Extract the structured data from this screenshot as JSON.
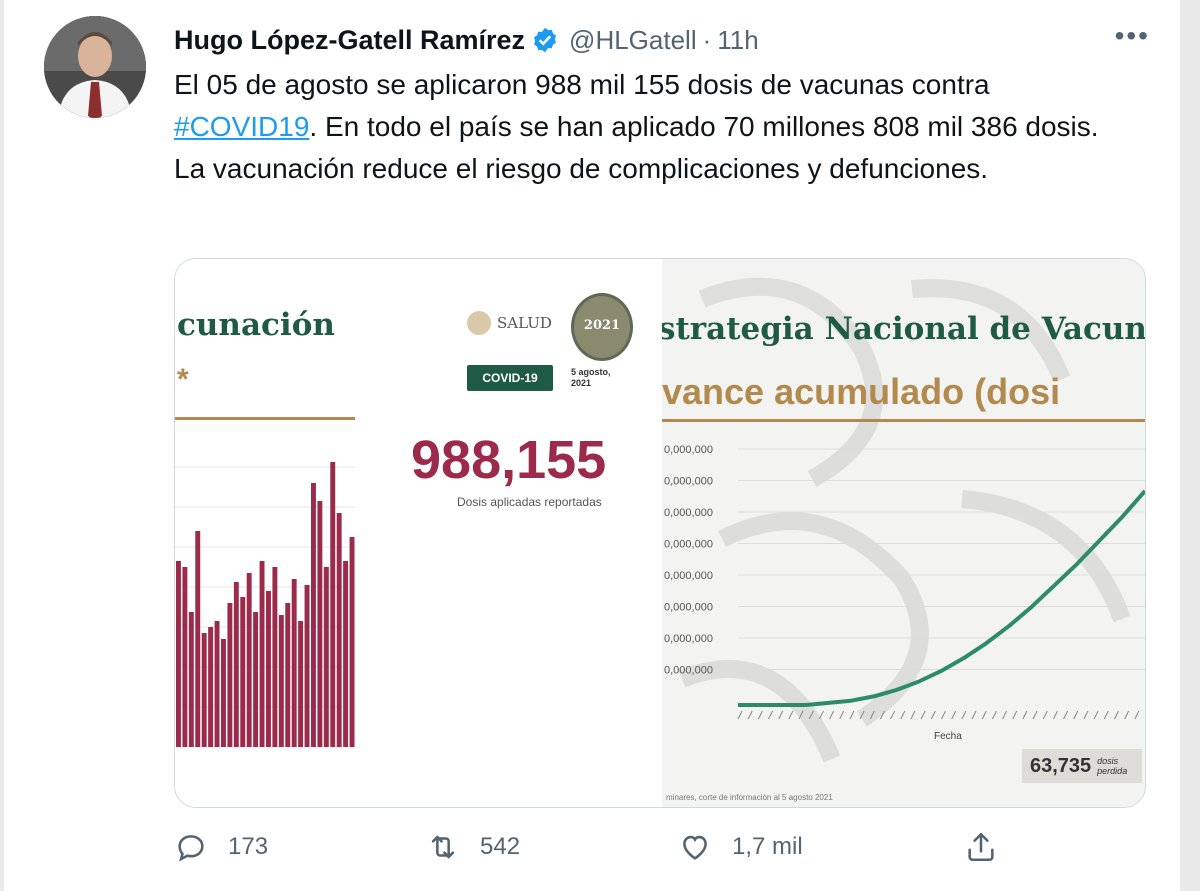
{
  "author": {
    "name": "Hugo López-Gatell Ramírez",
    "handle": "@HLGatell",
    "separator": "·",
    "time": "11h"
  },
  "more_menu": "•••",
  "tweet": {
    "text_before": "El 05 de agosto se aplicaron 988 mil 155 dosis de vacunas contra ",
    "hashtag": "#COVID19",
    "text_after": ". En todo el país se han aplicado 70 millones 808 mil 386 dosis. La vacunación reduce el riesgo de complicaciones y defunciones."
  },
  "media": {
    "left": {
      "title": "cunación",
      "star": "*",
      "logo_text": "SALUD",
      "emblem_year": "2021",
      "badge": "COVID-19",
      "date_line1": "5 agosto,",
      "date_line2": "2021",
      "big_number": "988,155",
      "big_caption": "Dosis aplicadas reportadas",
      "bar_heights": [
        0.62,
        0.6,
        0.45,
        0.72,
        0.38,
        0.4,
        0.42,
        0.36,
        0.48,
        0.55,
        0.5,
        0.58,
        0.45,
        0.62,
        0.52,
        0.6,
        0.44,
        0.48,
        0.56,
        0.42,
        0.54,
        0.88,
        0.82,
        0.6,
        0.95,
        0.78,
        0.62,
        0.7
      ]
    },
    "right": {
      "title": "strategia Nacional de Vacuna",
      "subtitle": "vance acumulado (dosi",
      "y_tick_labels": [
        "0,000,000",
        "0,000,000",
        "0,000,000",
        "0,000,000",
        "0,000,000",
        "0,000,000",
        "0,000,000",
        "0,000,000"
      ],
      "x_label": "Fecha",
      "box_number": "63,735",
      "box_label_line1": "dosis",
      "box_label_line2": "perdida",
      "footer": "minares, corte de información al 5 agosto 2021",
      "curve_series": [
        0.0,
        0.0,
        0.0,
        0.0,
        0.01,
        0.02,
        0.04,
        0.07,
        0.11,
        0.16,
        0.22,
        0.29,
        0.37,
        0.46,
        0.56,
        0.66,
        0.77,
        0.88,
        1.0
      ]
    }
  },
  "actions": {
    "reply_count": "173",
    "retweet_count": "542",
    "like_count": "1,7 mil"
  },
  "colors": {
    "link": "#1d9bf0",
    "verified": "#1d9bf0",
    "text_secondary": "#536471",
    "gob_green": "#1f5a46",
    "gob_gold": "#b28a4d",
    "bar_red": "#9c2a4a",
    "curve_green": "#2e8b6a"
  }
}
